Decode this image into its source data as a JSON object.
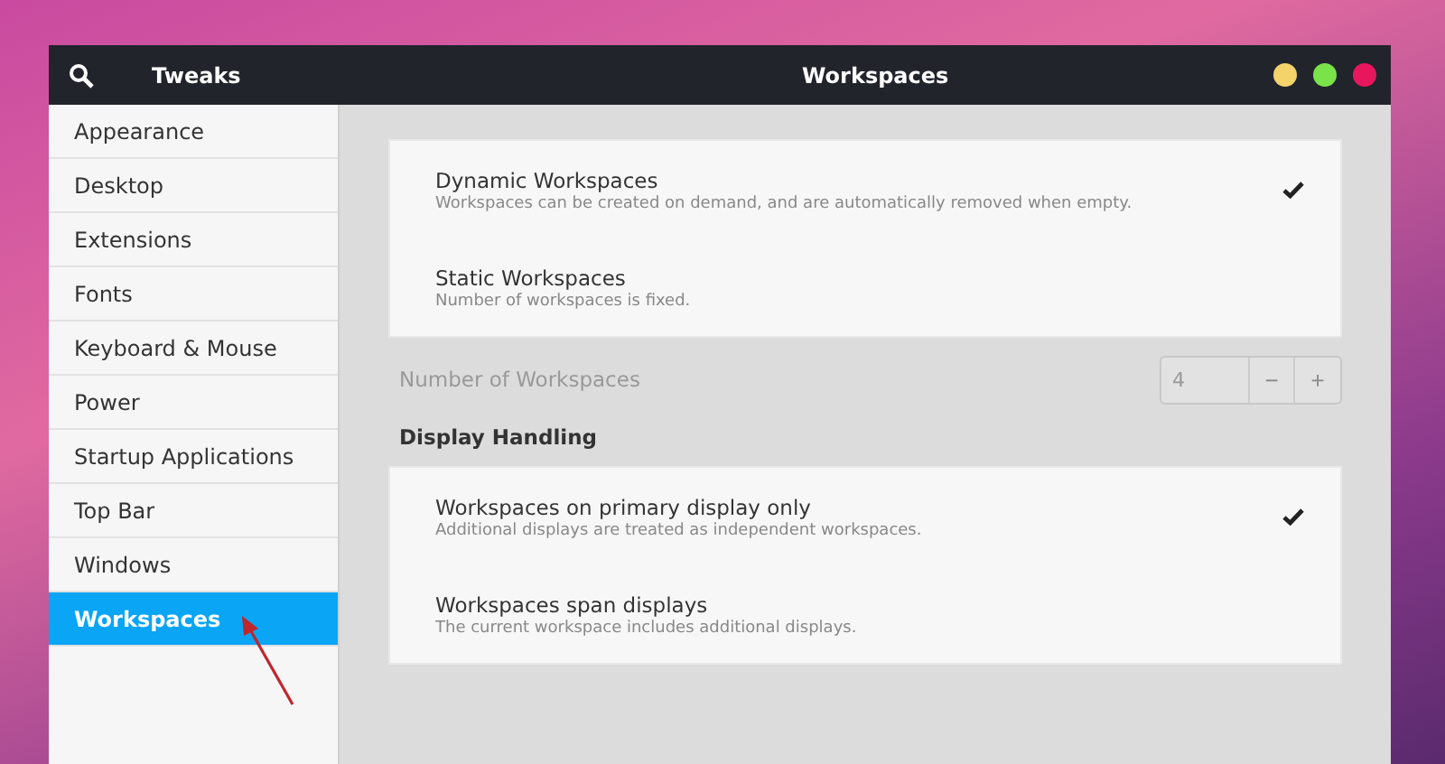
{
  "window": {
    "app_title": "Tweaks",
    "title": "Workspaces",
    "controls": [
      {
        "color": "#f5d36b"
      },
      {
        "color": "#7ae34a"
      },
      {
        "color": "#e8175d"
      }
    ]
  },
  "sidebar": {
    "items": [
      {
        "label": "Appearance",
        "selected": false
      },
      {
        "label": "Desktop",
        "selected": false
      },
      {
        "label": "Extensions",
        "selected": false
      },
      {
        "label": "Fonts",
        "selected": false
      },
      {
        "label": "Keyboard & Mouse",
        "selected": false
      },
      {
        "label": "Power",
        "selected": false
      },
      {
        "label": "Startup Applications",
        "selected": false
      },
      {
        "label": "Top Bar",
        "selected": false
      },
      {
        "label": "Windows",
        "selected": false
      },
      {
        "label": "Workspaces",
        "selected": true
      }
    ]
  },
  "workspace_mode": [
    {
      "title": "Dynamic Workspaces",
      "description": "Workspaces can be created on demand, and are automatically removed when empty.",
      "selected": true
    },
    {
      "title": "Static Workspaces",
      "description": "Number of workspaces is fixed.",
      "selected": false
    }
  ],
  "number_of_workspaces": {
    "label": "Number of Workspaces",
    "value": "4",
    "disabled": true,
    "minus": "−",
    "plus": "+"
  },
  "display_handling": {
    "heading": "Display Handling",
    "options": [
      {
        "title": "Workspaces on primary display only",
        "description": "Additional displays are treated as independent workspaces.",
        "selected": true
      },
      {
        "title": "Workspaces span displays",
        "description": "The current workspace includes additional displays.",
        "selected": false
      }
    ]
  }
}
